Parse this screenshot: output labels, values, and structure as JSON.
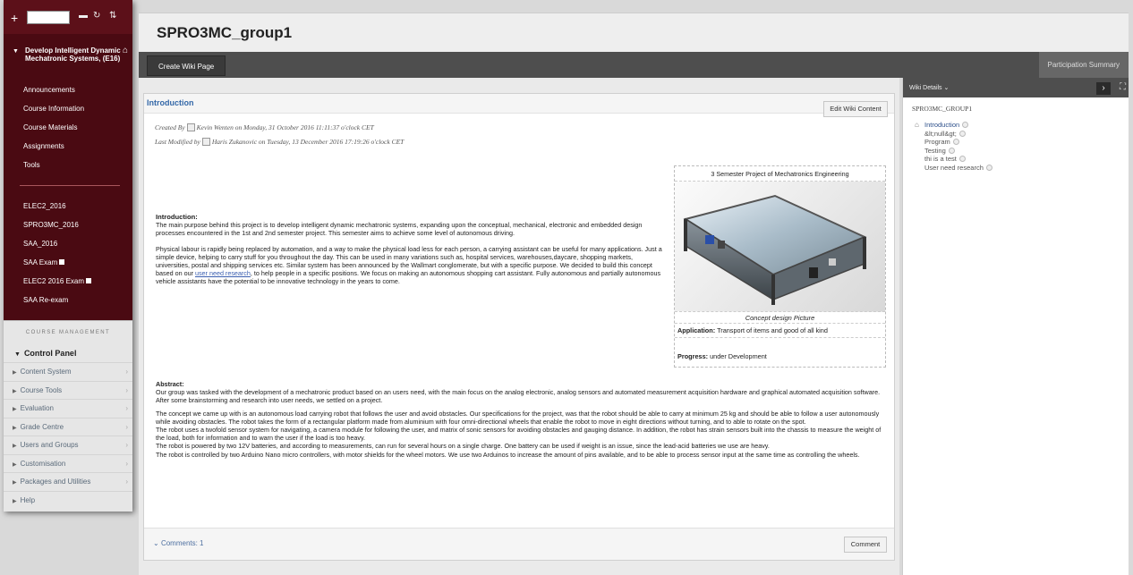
{
  "sidebar": {
    "course_title": "Develop Intelligent Dynamic Mechatronic Systems, (E16)",
    "menu": [
      "Announcements",
      "Course Information",
      "Course Materials",
      "Assignments",
      "Tools"
    ],
    "courses": [
      {
        "label": "ELEC2_2016",
        "flag": false
      },
      {
        "label": "SPRO3MC_2016",
        "flag": false
      },
      {
        "label": "SAA_2016",
        "flag": false
      },
      {
        "label": "SAA Exam",
        "flag": true
      },
      {
        "label": "ELEC2 2016 Exam",
        "flag": true
      },
      {
        "label": "SAA Re-exam",
        "flag": false
      }
    ],
    "management_heading": "COURSE MANAGEMENT",
    "control_panel": "Control Panel",
    "control_items": [
      {
        "label": "Content System",
        "chevron": true
      },
      {
        "label": "Course Tools",
        "chevron": true
      },
      {
        "label": "Evaluation",
        "chevron": true
      },
      {
        "label": "Grade Centre",
        "chevron": true
      },
      {
        "label": "Users and Groups",
        "chevron": true
      },
      {
        "label": "Customisation",
        "chevron": true
      },
      {
        "label": "Packages and Utilities",
        "chevron": true
      },
      {
        "label": "Help",
        "chevron": false
      }
    ]
  },
  "header": {
    "title": "SPRO3MC_group1"
  },
  "toolbar": {
    "create_label": "Create Wiki Page",
    "participation_label": "Participation Summary"
  },
  "wiki": {
    "title": "Introduction",
    "edit_label": "Edit Wiki Content",
    "created_prefix": "Created By",
    "created_rest": "Kevin Wenten on Monday, 31 October 2016 11:11:37 o'clock CET",
    "modified_prefix": "Last Modified by",
    "modified_rest": "Haris Zukanovic on Tuesday, 13 December 2016 17:19:26 o'clock CET",
    "intro_heading": "Introduction:",
    "intro_p1": "The main purpose behind this project is to develop intelligent dynamic mechatronic systems, expanding upon the conceptual, mechanical, electronic and embedded design processes encountered in the 1st and 2nd semester project. This semester aims to achieve some level of autonomous driving.",
    "intro_p2_a": "Physical labour is rapidly being replaced by automation, and a way to make the physical load less for each person, a carrying assistant can be useful for many applications. Just a simple device, helping to carry stuff for you throughout the day. This can be used in many variations such as, hospital services, warehouses,daycare, shopping markets, universities, postal and shipping services etc. Similar system has been announced by the Wallmart conglomerate, but with a specific purpose. We decided to build this concept based on our",
    "intro_link": "user need research",
    "intro_p2_b": ", to help people in a specific positions. We focus on making an autonomous shopping cart assistant. Fully autonomous and partially autonomous vehicle assistants have the potential to be innovative technology in the years to come.",
    "image_title": "3 Semester Project of Mechatronics Engineering",
    "image_caption": "Concept design Picture",
    "application_label": "Application:",
    "application_value": "Transport of items and good of all kind",
    "progress_label": "Progress:",
    "progress_value": "under Development",
    "abstract_heading": "Abstract:",
    "abstract_p1": "Our group was tasked with the development of a mechatronic product based on an users need, with the main focus on the analog electronic, analog sensors and automated measurement acquisition hardware and graphical automated acquisition software. After some brainstorming and research into user needs, we settled on a project.",
    "abstract_p2": "The concept we came up with is an autonomous load carrying robot that follows the user and avoid obstacles. Our specifications for the project, was that the robot should be able to carry at minimum 25 kg and should be able to follow a user autonomously while avoiding obstacles. The robot takes the form of a rectangular platform made from aluminium with four omni-directional wheels that enable the robot to move in eight directions without turning, and to able to rotate on the spot.",
    "abstract_p3": "The robot uses a twofold sensor system for navigating, a camera module for following the user, and matrix of sonic sensors for avoiding obstacles and gauging distance. In addition, the robot has strain sensors built into the chassis to measure the weight of the load, both for information and to warn the user if the load is too heavy.",
    "abstract_p4": "The robot is powered by two 12V batteries, and according to measurements, can run for several hours on a single charge. One battery can be used if weight is an issue, since the lead-acid batteries we use are heavy.",
    "abstract_p5": "The robot is controlled by two Arduino Nano micro controllers, with motor shields for the wheel motors. We use two Arduinos to increase the amount of pins available, and to be able to process sensor input at the same time as controlling the wheels.",
    "comments_label": "Comments: 1",
    "comment_button": "Comment"
  },
  "details": {
    "title": "Wiki Details",
    "group": "SPRO3MC_GROUP1",
    "pages": [
      "Introduction",
      "&lt;null&gt;",
      "Program",
      "Testing",
      "thi is a test",
      "User need research"
    ]
  },
  "colors": {
    "sidebar": "#4a0a12",
    "link": "#3468a8",
    "toolbar": "#4e4e4e"
  }
}
